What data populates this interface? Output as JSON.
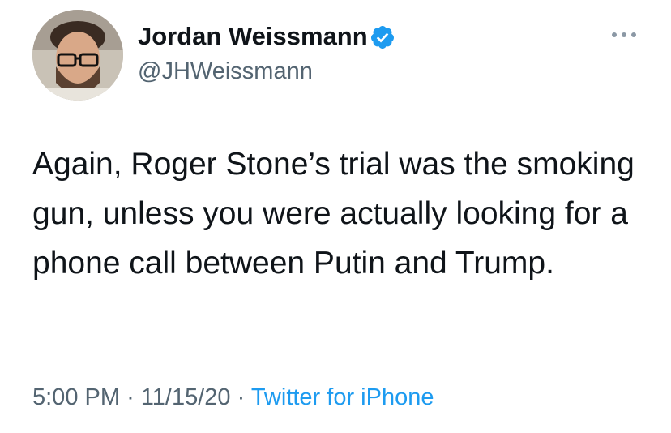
{
  "tweet": {
    "author": {
      "display_name": "Jordan Weissmann",
      "handle": "@JHWeissmann",
      "verified": true
    },
    "text": "Again, Roger Stone’s trial was the smoking gun, unless you were actually looking for a phone call between Putin and Trump.",
    "time": "5:00 PM",
    "separator": "·",
    "date": "11/15/20",
    "source": "Twitter for iPhone"
  },
  "colors": {
    "text": "#0f1419",
    "secondary": "#536471",
    "accent": "#1d9bf0"
  },
  "icons": {
    "verified": "verified-badge-icon",
    "more": "more-options-icon"
  }
}
